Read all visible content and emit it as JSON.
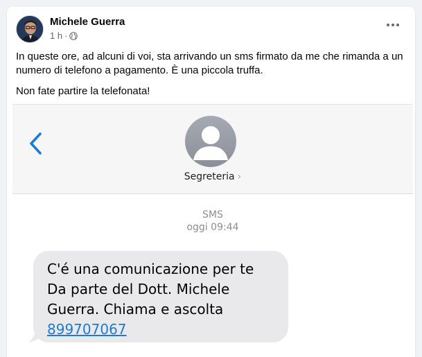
{
  "post": {
    "author": "Michele Guerra",
    "time": "1 h",
    "separator": "·",
    "paragraphs": [
      "In queste ore, ad alcuni di voi, sta arrivando un sms firmato da me che rimanda a un numero di telefono a pagamento. È una piccola truffa.",
      "Non fate partire la telefonata!"
    ]
  },
  "sms": {
    "contact_name": "Segreteria",
    "contact_arrow": "›",
    "channel": "SMS",
    "timestamp": "oggi 09:44",
    "message_lines": [
      "C'é una comunicazione per te",
      "Da parte del Dott. Michele",
      "Guerra. Chiama e ascolta"
    ],
    "phone_number": "899707067"
  },
  "colors": {
    "ios_blue": "#1c7cd5",
    "bubble_gray": "#e9e9eb",
    "facebook_meta": "#65676b"
  },
  "icons": {
    "privacy": "globe-icon",
    "menu": "more-options-icon",
    "back": "chevron-left-icon",
    "contact": "person-icon"
  }
}
